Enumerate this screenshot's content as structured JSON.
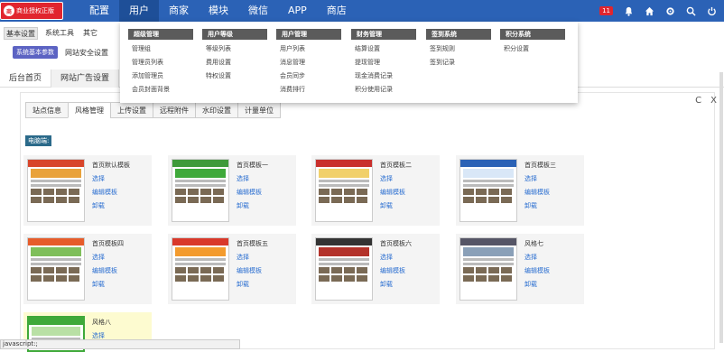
{
  "logo": {
    "badge": "商",
    "text": "商业授权正版"
  },
  "topnav": [
    {
      "label": "配置"
    },
    {
      "label": "用户"
    },
    {
      "label": "商家"
    },
    {
      "label": "模块"
    },
    {
      "label": "微信"
    },
    {
      "label": "APP"
    },
    {
      "label": "商店"
    }
  ],
  "notification_count": "11",
  "subbar": {
    "tabs": [
      "基本设置",
      "系统工具",
      "其它"
    ]
  },
  "rowb": {
    "pill": "系统基本参数",
    "link": "网站安全设置"
  },
  "pagetabs": [
    "后台首页",
    "网站广告设置"
  ],
  "content_tabs": [
    "站点信息",
    "风格管理",
    "上传设置",
    "远程附件",
    "水印设置",
    "计量单位"
  ],
  "pc_label": "电脑端:",
  "templates": [
    {
      "name": "首页默认模板",
      "links": [
        "选择",
        "编辑模板",
        "卸载"
      ]
    },
    {
      "name": "首页模板一",
      "links": [
        "选择",
        "编辑模板",
        "卸载"
      ]
    },
    {
      "name": "首页模板二",
      "links": [
        "选择",
        "编辑模板",
        "卸载"
      ]
    },
    {
      "name": "首页模板三",
      "links": [
        "选择",
        "编辑模板",
        "卸载"
      ]
    },
    {
      "name": "首页模板四",
      "links": [
        "选择",
        "编辑模板",
        "卸载"
      ]
    },
    {
      "name": "首页模板五",
      "links": [
        "选择",
        "编辑模板",
        "卸载"
      ]
    },
    {
      "name": "首页模板六",
      "links": [
        "选择",
        "编辑模板",
        "卸载"
      ]
    },
    {
      "name": "风格七",
      "links": [
        "选择",
        "编辑模板",
        "卸载"
      ]
    },
    {
      "name": "风格八",
      "links": [
        "选择"
      ]
    }
  ],
  "dropdown": {
    "columns": [
      {
        "header": "超级管理",
        "items": [
          "管理组",
          "管理员列表",
          "添加管理员",
          "会员封面背景"
        ]
      },
      {
        "header": "用户等级",
        "items": [
          "等级列表",
          "费用设置",
          "特权设置"
        ]
      },
      {
        "header": "用户管理",
        "items": [
          "用户列表",
          "消息管理",
          "会员同步",
          "消费排行"
        ]
      },
      {
        "header": "财务管理",
        "items": [
          "结算设置",
          "提现管理",
          "现金消费记录",
          "积分使用记录"
        ]
      },
      {
        "header": "签到系统",
        "items": [
          "签到规则",
          "签到记录"
        ]
      },
      {
        "header": "积分系统",
        "items": [
          "积分设置"
        ]
      }
    ]
  },
  "window_controls": {
    "refresh": "C",
    "close": "X"
  },
  "statusbar": "javascript:;"
}
